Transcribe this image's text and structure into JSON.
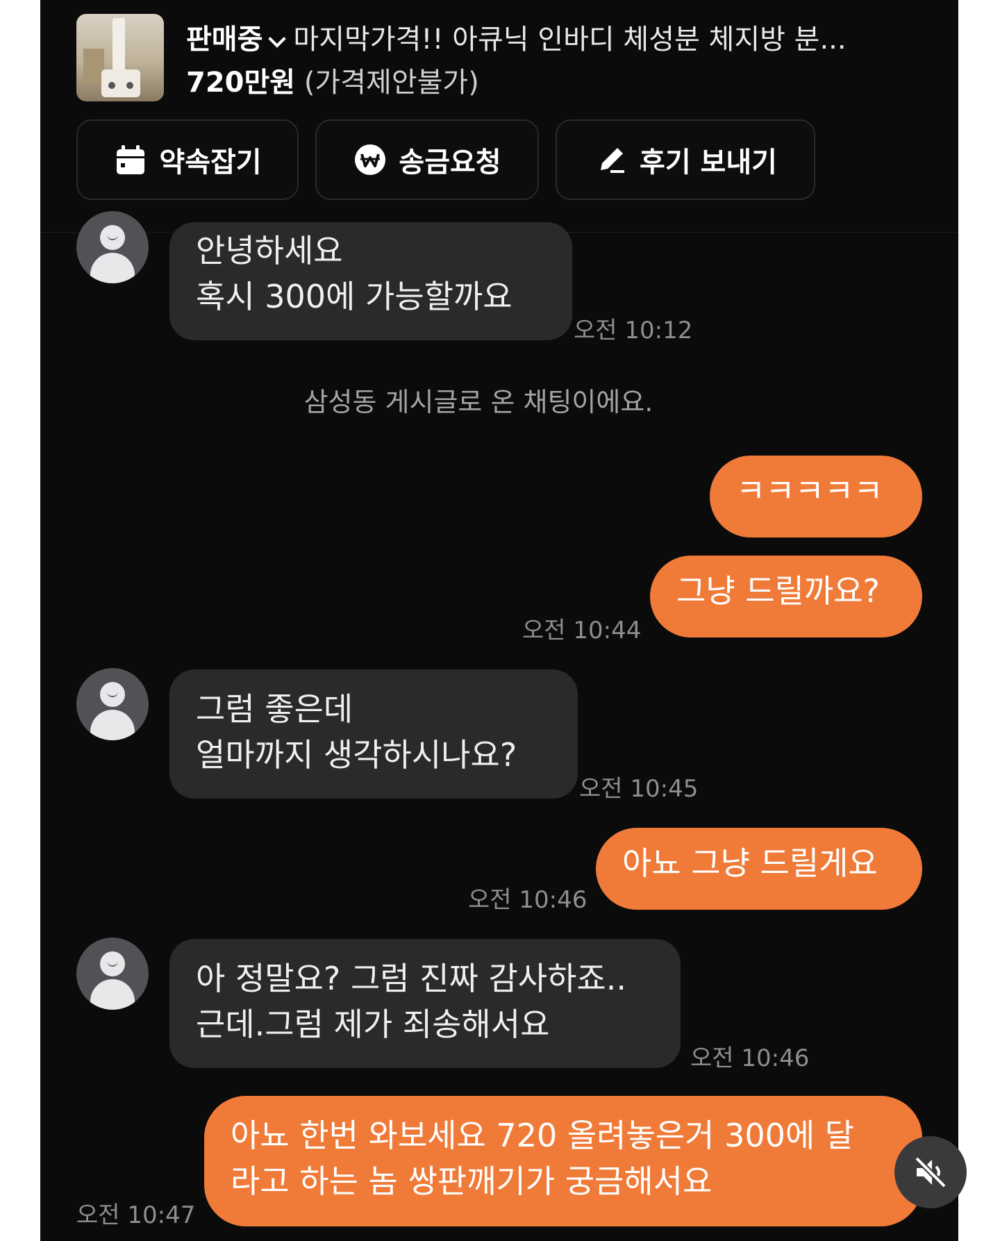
{
  "header": {
    "status": "판매중",
    "product_title": "마지막가격!! 아큐닉 인바디 체성분 체지방 분...",
    "price": "720만원",
    "price_note": "(가격제안불가)"
  },
  "actions": [
    {
      "label": "약속잡기",
      "icon": "calendar-icon"
    },
    {
      "label": "송금요청",
      "icon": "won-coin-icon"
    },
    {
      "label": "후기 보내기",
      "icon": "pencil-icon"
    }
  ],
  "notice": "삼성동 게시글로 온 채팅이에요.",
  "messages": [
    {
      "from": "them",
      "lines": [
        "안녕하세요",
        "혹시 300에 가능할까요"
      ],
      "time": "오전 10:12"
    },
    {
      "from": "me",
      "lines": [
        "ㅋㅋㅋㅋㅋ"
      ],
      "time": ""
    },
    {
      "from": "me",
      "lines": [
        "그냥 드릴까요?"
      ],
      "time": "오전 10:44"
    },
    {
      "from": "them",
      "lines": [
        "그럼 좋은데",
        "얼마까지 생각하시나요?"
      ],
      "time": "오전 10:45"
    },
    {
      "from": "me",
      "lines": [
        "아뇨 그냥 드릴게요"
      ],
      "time": "오전 10:46"
    },
    {
      "from": "them",
      "lines": [
        "아 정말요? 그럼 진짜 감사하죠..",
        "근데.그럼 제가 죄송해서요"
      ],
      "time": "오전 10:46"
    },
    {
      "from": "me",
      "lines": [
        "아뇨 한번 와보세요 720 올려놓은거 300에 달",
        "라고 하는 놈 쌍판깨기가 궁금해서요"
      ],
      "time": "오전 10:47"
    }
  ],
  "colors": {
    "outgoing_bubble": "#f07b39",
    "incoming_bubble": "#2a2a2c",
    "background": "#0b0b0c"
  },
  "overlay": {
    "icon": "muted-speaker-icon"
  }
}
